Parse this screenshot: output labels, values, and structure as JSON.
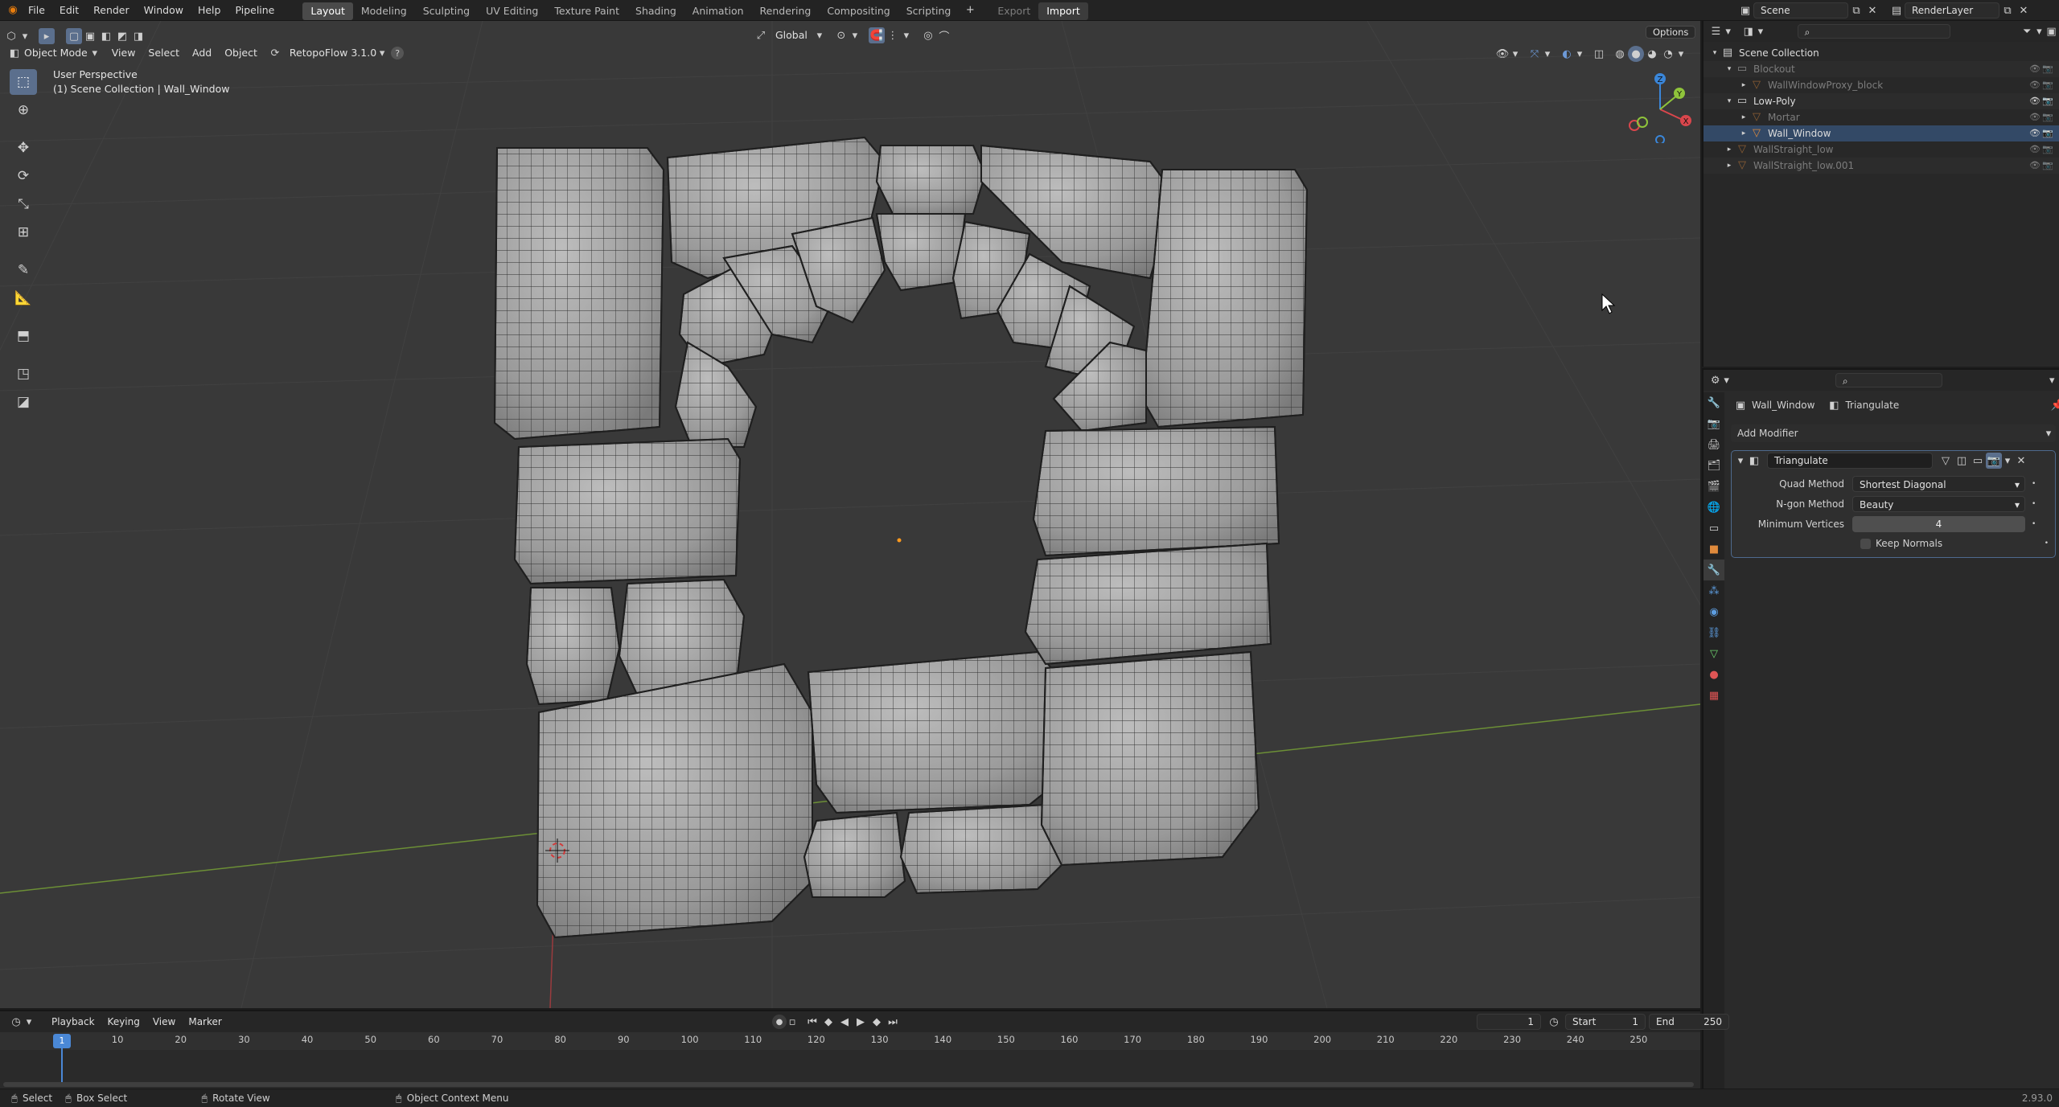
{
  "menu": [
    "File",
    "Edit",
    "Render",
    "Window",
    "Help",
    "Pipeline"
  ],
  "workspaces": [
    "Layout",
    "Modeling",
    "Sculpting",
    "UV Editing",
    "Texture Paint",
    "Shading",
    "Animation",
    "Rendering",
    "Compositing",
    "Scripting"
  ],
  "active_workspace": "Layout",
  "topbar": {
    "export_label": "Export",
    "import_label": "Import",
    "scene": "Scene",
    "render_layer": "RenderLayer"
  },
  "viewport": {
    "mode": "Object Mode",
    "menus": [
      "View",
      "Select",
      "Add",
      "Object"
    ],
    "addon": "RetopoFlow 3.1.0",
    "transform_orientation": "Global",
    "options_label": "Options",
    "perspective_text": "User Perspective",
    "collection_text": "(1) Scene Collection | Wall_Window",
    "accent_color": "#5b6f8d",
    "axis_x_color": "#d9464c",
    "axis_y_color": "#8fc43b",
    "axis_z_color": "#3a86d9"
  },
  "outliner": {
    "rows": [
      {
        "label": "Scene Collection",
        "indent": 0,
        "type": "scene"
      },
      {
        "label": "Blockout",
        "indent": 1,
        "type": "collection",
        "dim": true
      },
      {
        "label": "WallWindowProxy_block",
        "indent": 2,
        "type": "object",
        "dim": true
      },
      {
        "label": "Low-Poly",
        "indent": 1,
        "type": "collection",
        "dim": false
      },
      {
        "label": "Mortar",
        "indent": 2,
        "type": "object",
        "dim": true
      },
      {
        "label": "Wall_Window",
        "indent": 2,
        "type": "object",
        "dim": false
      },
      {
        "label": "WallStraight_low",
        "indent": 1,
        "type": "object",
        "dim": true
      },
      {
        "label": "WallStraight_low.001",
        "indent": 1,
        "type": "object",
        "dim": true
      }
    ]
  },
  "properties": {
    "object_name": "Wall_Window",
    "modifier_breadcrumb": "Triangulate",
    "add_modifier_label": "Add Modifier",
    "modifier_name": "Triangulate",
    "fields": [
      {
        "label": "Quad Method",
        "value": "Shortest Diagonal",
        "kind": "select"
      },
      {
        "label": "N-gon Method",
        "value": "Beauty",
        "kind": "select"
      },
      {
        "label": "Minimum Vertices",
        "value": "4",
        "kind": "number"
      }
    ],
    "keep_normals_label": "Keep Normals",
    "keep_normals_checked": false
  },
  "timeline": {
    "menus": [
      "Playback",
      "Keying",
      "View",
      "Marker"
    ],
    "current_frame": "1",
    "start_label": "Start",
    "start": "1",
    "end_label": "End",
    "end": "250",
    "ticks": [
      "1",
      "10",
      "20",
      "30",
      "40",
      "50",
      "60",
      "70",
      "80",
      "90",
      "100",
      "110",
      "120",
      "130",
      "140",
      "150",
      "160",
      "170",
      "180",
      "190",
      "200",
      "210",
      "220",
      "230",
      "240",
      "250"
    ]
  },
  "status": {
    "select": "Select",
    "box_select": "Box Select",
    "rotate_view": "Rotate View",
    "context_menu": "Object Context Menu",
    "version": "2.93.0"
  }
}
